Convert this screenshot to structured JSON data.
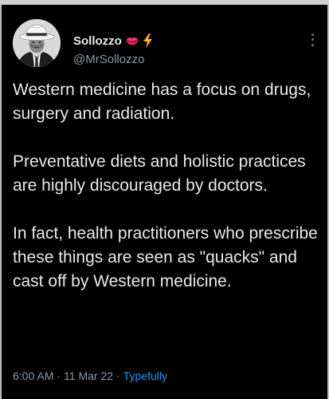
{
  "author": {
    "display_name": "Sollozzo",
    "handle": "@MrSollozzo",
    "emojis": [
      "lips-emoji",
      "lightning-emoji"
    ],
    "avatar_icon": "profile-photo-man-in-fedora"
  },
  "tweet": {
    "paragraphs": [
      "Western medicine has a focus on drugs, surgery and radiation.",
      "Preventative diets and holistic practices are highly discouraged by doctors.",
      "In fact, health practitioners who prescribe these things are seen as \"quacks\" and cast off by Western medicine."
    ]
  },
  "meta": {
    "time": "6:00 AM",
    "separator": "·",
    "date": "11 Mar 22",
    "source": "Typefully"
  },
  "colors": {
    "background": "#000000",
    "text": "#e7e9ea",
    "secondary": "#8b98a5",
    "link": "#1d9bf0"
  },
  "icons": {
    "more": "more-options-icon"
  }
}
